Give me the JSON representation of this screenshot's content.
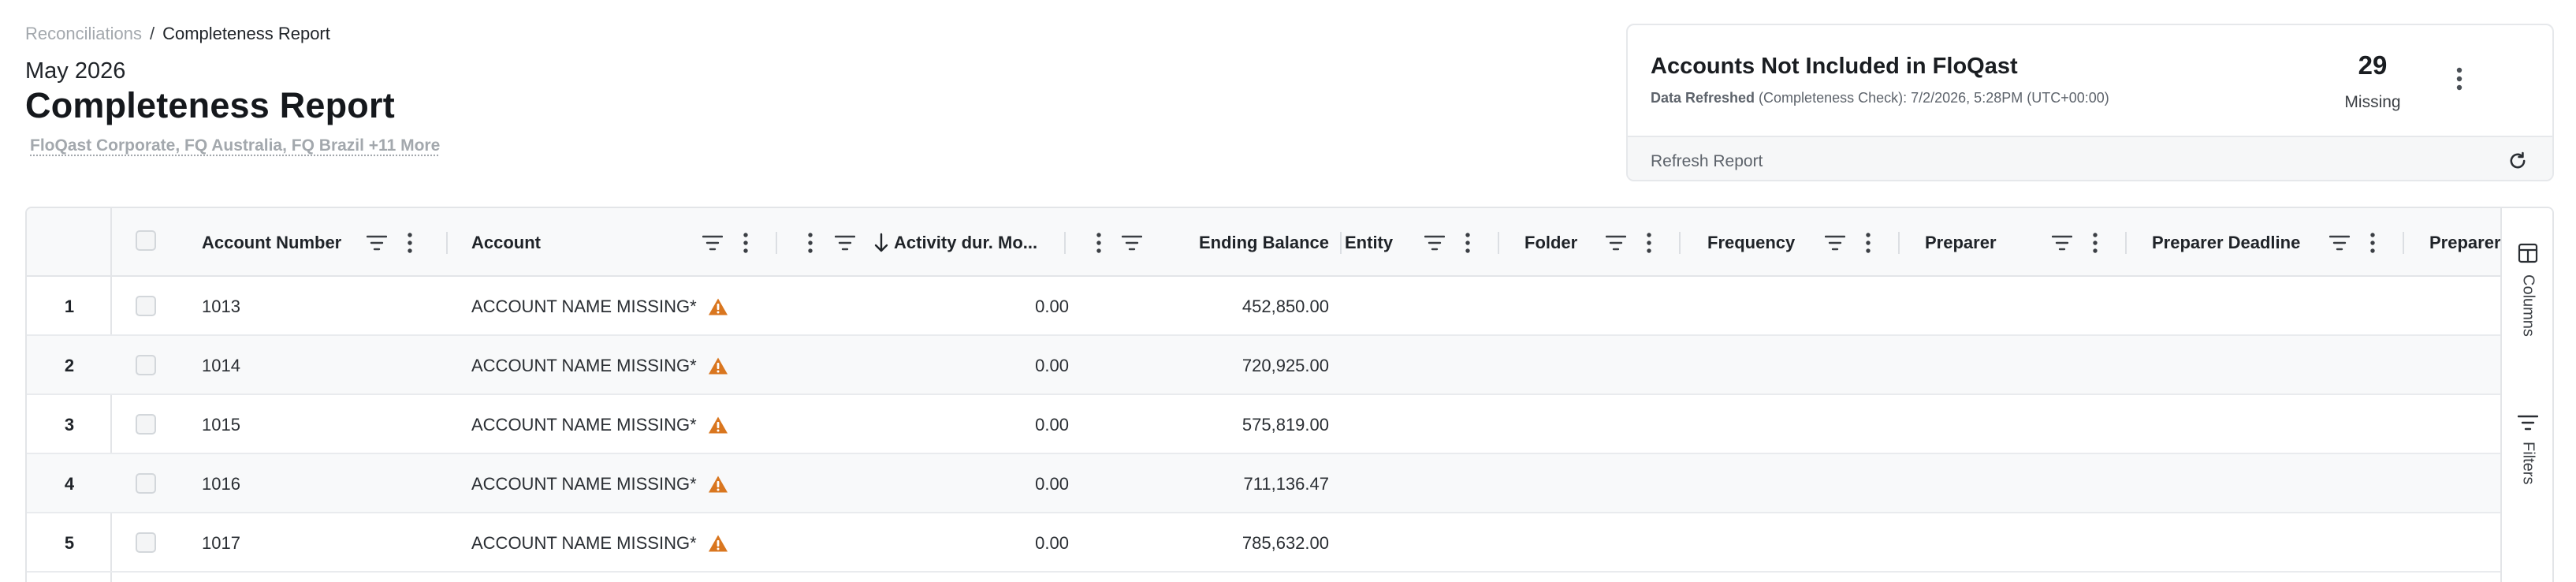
{
  "breadcrumb": {
    "parent": "Reconciliations",
    "separator": "/",
    "current": "Completeness Report"
  },
  "header": {
    "period": "May 2026",
    "title": "Completeness Report",
    "entities": "FloQast Corporate, FQ Australia, FQ Brazil +11 More"
  },
  "summary_card": {
    "title": "Accounts Not Included in FloQast",
    "refreshed_label": "Data Refreshed",
    "refreshed_detail": " (Completeness Check): 7/2/2026, 5:28PM (UTC+00:00)",
    "count": "29",
    "count_label": "Missing",
    "refresh_button": "Refresh Report"
  },
  "grid": {
    "columns": [
      {
        "key": "account_number",
        "label": "Account Number"
      },
      {
        "key": "account",
        "label": "Account"
      },
      {
        "key": "activity",
        "label": "Activity dur. Mo..."
      },
      {
        "key": "ending_balance",
        "label": "Ending Balance"
      },
      {
        "key": "entity",
        "label": "Entity"
      },
      {
        "key": "folder",
        "label": "Folder"
      },
      {
        "key": "frequency",
        "label": "Frequency"
      },
      {
        "key": "preparer",
        "label": "Preparer"
      },
      {
        "key": "preparer_deadline",
        "label": "Preparer Deadline"
      },
      {
        "key": "preparer_2",
        "label": "Preparer"
      }
    ],
    "rows": [
      {
        "n": "1",
        "account_number": "1013",
        "account": "ACCOUNT NAME MISSING*",
        "activity": "0.00",
        "ending_balance": "452,850.00"
      },
      {
        "n": "2",
        "account_number": "1014",
        "account": "ACCOUNT NAME MISSING*",
        "activity": "0.00",
        "ending_balance": "720,925.00"
      },
      {
        "n": "3",
        "account_number": "1015",
        "account": "ACCOUNT NAME MISSING*",
        "activity": "0.00",
        "ending_balance": "575,819.00"
      },
      {
        "n": "4",
        "account_number": "1016",
        "account": "ACCOUNT NAME MISSING*",
        "activity": "0.00",
        "ending_balance": "711,136.47"
      },
      {
        "n": "5",
        "account_number": "1017",
        "account": "ACCOUNT NAME MISSING*",
        "activity": "0.00",
        "ending_balance": "785,632.00"
      }
    ],
    "side_tabs": {
      "columns": "Columns",
      "filters": "Filters"
    }
  },
  "icons": {
    "kebab": "kebab-vertical-icon",
    "filter": "filter-lines-icon",
    "refresh": "refresh-icon",
    "warning": "warning-triangle-icon",
    "sort": "arrow-down-icon",
    "columns": "columns-icon"
  },
  "colors": {
    "warning": "#d9761f",
    "muted": "#a3a8ad",
    "border": "#e3e5e8"
  }
}
